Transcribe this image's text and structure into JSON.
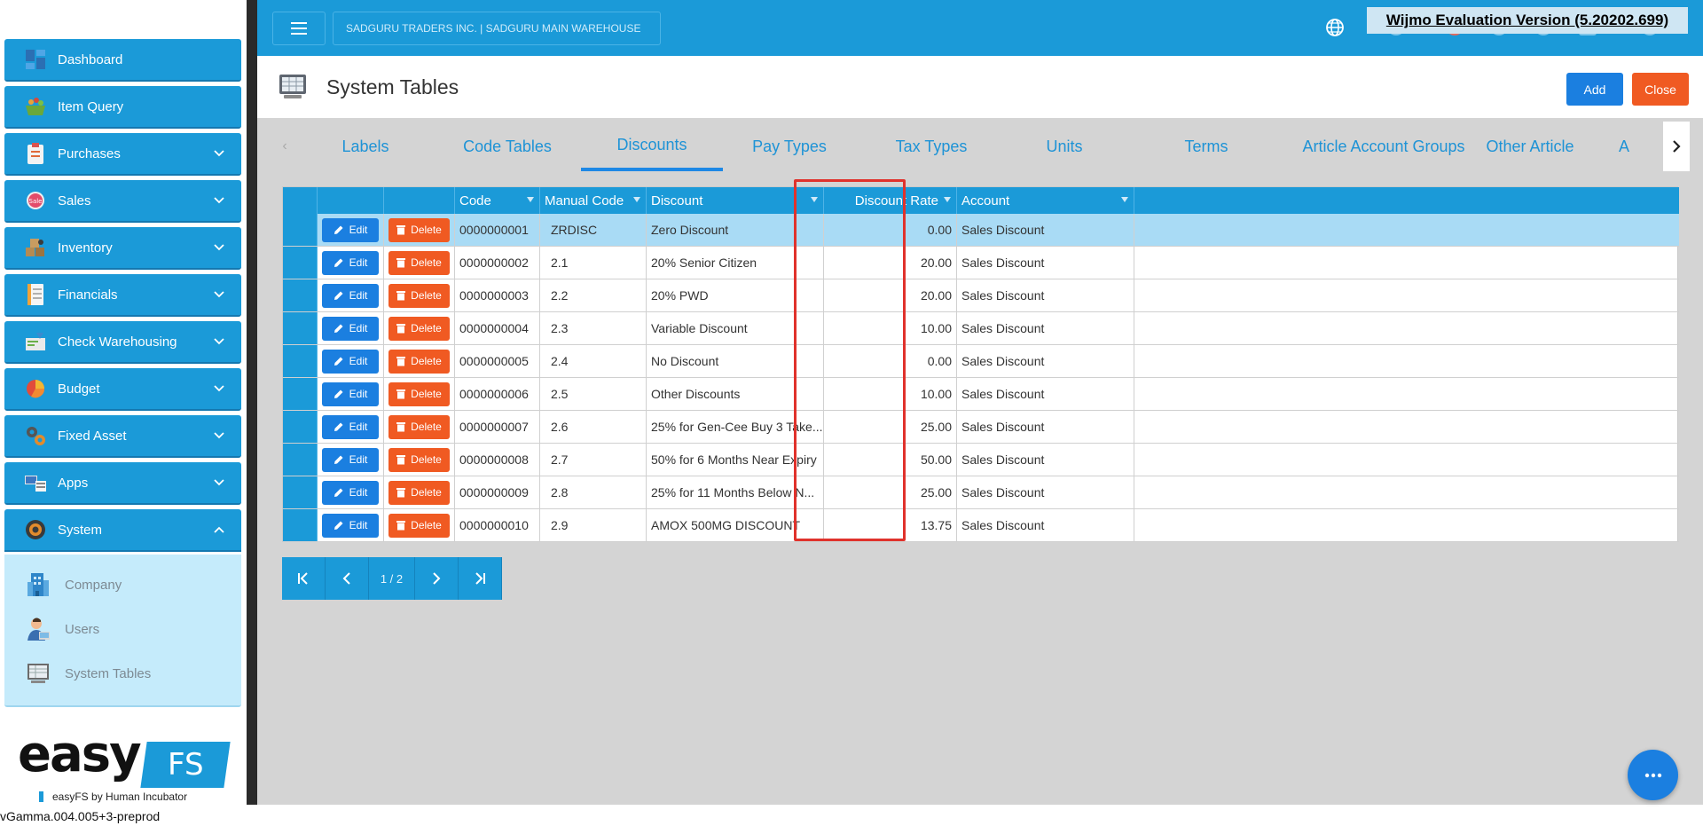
{
  "sidebar": {
    "items": [
      {
        "label": "Dashboard",
        "icon": "dashboard-icon",
        "expandable": false
      },
      {
        "label": "Item Query",
        "icon": "basket-icon",
        "expandable": false
      },
      {
        "label": "Purchases",
        "icon": "clipboard-icon",
        "expandable": true
      },
      {
        "label": "Sales",
        "icon": "sale-tag-icon",
        "expandable": true
      },
      {
        "label": "Inventory",
        "icon": "boxes-icon",
        "expandable": true
      },
      {
        "label": "Financials",
        "icon": "ledger-icon",
        "expandable": true
      },
      {
        "label": "Check Warehousing",
        "icon": "check-icon",
        "expandable": true
      },
      {
        "label": "Budget",
        "icon": "pie-chart-icon",
        "expandable": true
      },
      {
        "label": "Fixed Asset",
        "icon": "gears-icon",
        "expandable": true
      },
      {
        "label": "Apps",
        "icon": "apps-icon",
        "expandable": true
      },
      {
        "label": "System",
        "icon": "cog-icon",
        "expandable": true,
        "expanded": true
      }
    ],
    "system_submenu": [
      {
        "label": "Company",
        "icon": "building-icon"
      },
      {
        "label": "Users",
        "icon": "user-icon"
      },
      {
        "label": "System Tables",
        "icon": "tables-icon"
      }
    ],
    "logo": {
      "word": "easy",
      "badge": "FS",
      "tagline": "easyFS by Human Incubator"
    },
    "version": "vGamma.004.005+3-preprod"
  },
  "topbar": {
    "company": "SADGURU TRADERS INC. | SADGURU MAIN WAREHOUSE",
    "eval_banner": "Wijmo Evaluation Version (5.20202.699)"
  },
  "page": {
    "title": "System Tables",
    "add_label": "Add",
    "close_label": "Close"
  },
  "tabs": [
    {
      "label": "Labels"
    },
    {
      "label": "Code Tables"
    },
    {
      "label": "Discounts",
      "active": true
    },
    {
      "label": "Pay Types"
    },
    {
      "label": "Tax Types"
    },
    {
      "label": "Units"
    },
    {
      "label": "Terms"
    },
    {
      "label": "Article Account Groups"
    },
    {
      "label": "Other Article"
    },
    {
      "label": "A"
    }
  ],
  "grid": {
    "columns": {
      "code": "Code",
      "manual_code": "Manual Code",
      "discount": "Discount",
      "discount_rate": "Discount Rate",
      "account": "Account"
    },
    "edit_label": "Edit",
    "delete_label": "Delete",
    "rows": [
      {
        "code": "0000000001",
        "manual_code": "ZRDISC",
        "discount": "Zero Discount",
        "discount_rate": "0.00",
        "account": "Sales Discount"
      },
      {
        "code": "0000000002",
        "manual_code": "2.1",
        "discount": "20% Senior Citizen",
        "discount_rate": "20.00",
        "account": "Sales Discount"
      },
      {
        "code": "0000000003",
        "manual_code": "2.2",
        "discount": "20% PWD",
        "discount_rate": "20.00",
        "account": "Sales Discount"
      },
      {
        "code": "0000000004",
        "manual_code": "2.3",
        "discount": "Variable Discount",
        "discount_rate": "10.00",
        "account": "Sales Discount"
      },
      {
        "code": "0000000005",
        "manual_code": "2.4",
        "discount": "No Discount",
        "discount_rate": "0.00",
        "account": "Sales Discount"
      },
      {
        "code": "0000000006",
        "manual_code": "2.5",
        "discount": "Other Discounts",
        "discount_rate": "10.00",
        "account": "Sales Discount"
      },
      {
        "code": "0000000007",
        "manual_code": "2.6",
        "discount": "25% for Gen-Cee Buy 3 Take...",
        "discount_rate": "25.00",
        "account": "Sales Discount"
      },
      {
        "code": "0000000008",
        "manual_code": "2.7",
        "discount": "50% for 6 Months Near Expiry",
        "discount_rate": "50.00",
        "account": "Sales Discount"
      },
      {
        "code": "0000000009",
        "manual_code": "2.8",
        "discount": "25% for 11 Months Below N...",
        "discount_rate": "25.00",
        "account": "Sales Discount"
      },
      {
        "code": "0000000010",
        "manual_code": "2.9",
        "discount": "AMOX 500MG DISCOUNT",
        "discount_rate": "13.75",
        "account": "Sales Discount"
      }
    ]
  },
  "pager": {
    "label": "1 / 2"
  },
  "colors": {
    "primary": "#1b9ad8",
    "button_blue": "#1b7fe0",
    "danger": "#f05a22",
    "highlight": "#e0322c"
  }
}
